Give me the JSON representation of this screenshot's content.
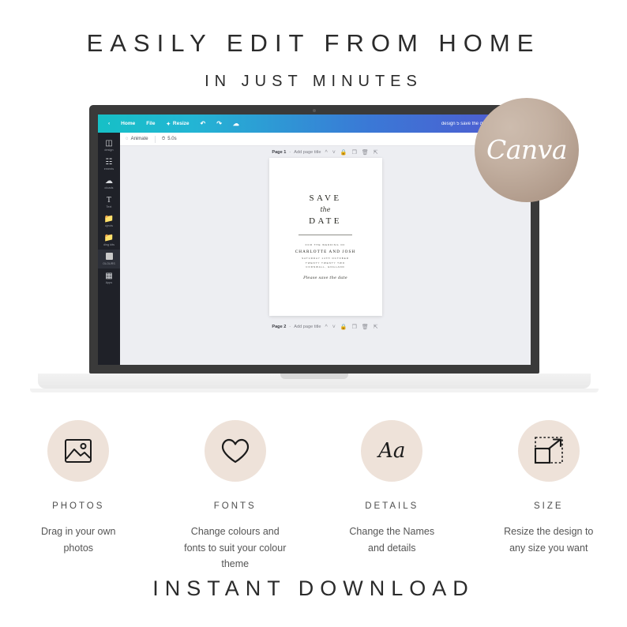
{
  "headline": {
    "line1": "EASILY EDIT FROM HOME",
    "line2": "IN JUST MINUTES"
  },
  "badge": {
    "label": "Canva"
  },
  "canva_app": {
    "topbar": {
      "home": "Home",
      "file": "File",
      "resize": "Resize",
      "undo_icon": "undo-icon",
      "redo_icon": "redo-icon",
      "cloud_icon": "cloud-save-icon",
      "document_title": "design 5 save the dat"
    },
    "sub_toolbar": {
      "animate": "Animate",
      "duration": "5.0s",
      "animate_icon": "animate-icon",
      "timer_icon": "timer-icon"
    },
    "sidebar": {
      "items": [
        {
          "label": "design",
          "icon": "design-icon"
        },
        {
          "label": "ements",
          "icon": "elements-icon"
        },
        {
          "label": "oloads",
          "icon": "uploads-icon"
        },
        {
          "label": "Text",
          "icon": "text-icon"
        },
        {
          "label": "ojects",
          "icon": "projects-icon"
        },
        {
          "label": "ding kits",
          "icon": "branding-kit-icon"
        },
        {
          "label": "OLOURS",
          "icon": "colours-swatch-icon"
        },
        {
          "label": "Apps",
          "icon": "apps-grid-icon"
        }
      ]
    },
    "pages": [
      {
        "number_label": "Page 1",
        "dash": "-",
        "add_title": "Add page title",
        "icons": [
          "chevron-up-icon",
          "chevron-down-icon",
          "lock-icon",
          "duplicate-icon",
          "trash-icon",
          "export-icon"
        ]
      },
      {
        "number_label": "Page 2",
        "dash": "-",
        "add_title": "Add page title",
        "icons": [
          "chevron-up-icon",
          "chevron-down-icon",
          "lock-icon",
          "duplicate-icon",
          "trash-icon",
          "export-icon"
        ]
      }
    ],
    "rotate_button_icon": "rotate-icon"
  },
  "invitation": {
    "save": "SAVE",
    "the": "the",
    "date": "DATE",
    "for_the_wedding_of": "FOR THE WEDDING OF",
    "names": "CHARLOTTE AND JOSH",
    "when": "SATURDAY 14TH OCTOBER",
    "year": "TWENTY TWENTY TWO",
    "place": "CORNWALL, ENGLAND",
    "signature": "Please save the date"
  },
  "features": [
    {
      "label": "PHOTOS",
      "icon": "image-icon",
      "description": "Drag in your own photos"
    },
    {
      "label": "FONTS",
      "icon": "heart-icon",
      "description": "Change colours and fonts to suit your colour theme"
    },
    {
      "label": "DETAILS",
      "icon": "aa-text-icon",
      "glyph": "Aa",
      "description": "Change the Names and details"
    },
    {
      "label": "SIZE",
      "icon": "resize-icon",
      "description": "Resize the design to any size you want"
    }
  ],
  "footer": {
    "text": "INSTANT DOWNLOAD"
  },
  "colors": {
    "accent_beige": "#eee2d9",
    "badge_brown": "#b09a8a",
    "topbar_teal": "#16c0c6",
    "topbar_blue": "#5257d0",
    "laptop_body": "#3a3a3a"
  }
}
